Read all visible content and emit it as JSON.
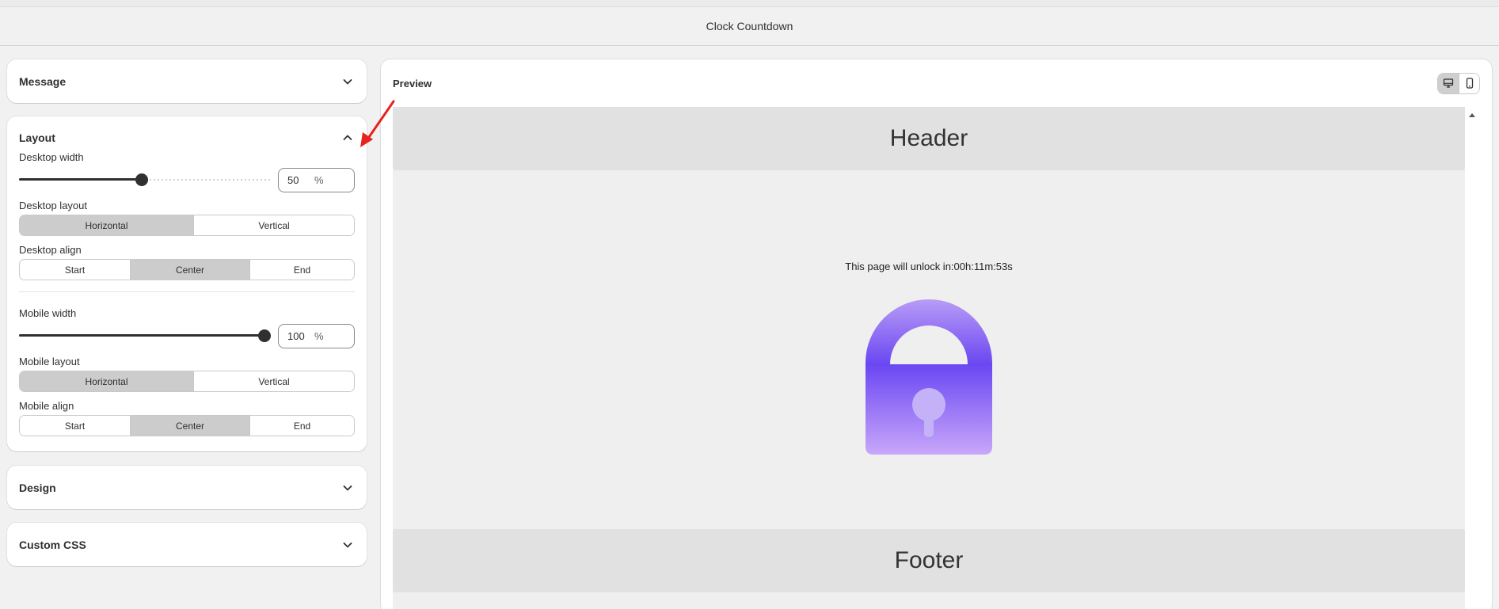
{
  "app": {
    "title": "Clock Countdown"
  },
  "sections": {
    "message": {
      "label": "Message",
      "icon": "chevron-down-icon"
    },
    "layout": {
      "label": "Layout",
      "icon": "chevron-up-icon",
      "desktop_width": {
        "label": "Desktop width",
        "value": "50",
        "unit": "%",
        "fraction": 0.5
      },
      "desktop_layout": {
        "label": "Desktop layout",
        "options": [
          "Horizontal",
          "Vertical"
        ],
        "selected": "Horizontal"
      },
      "desktop_align": {
        "label": "Desktop align",
        "options": [
          "Start",
          "Center",
          "End"
        ],
        "selected": "Center"
      },
      "mobile_width": {
        "label": "Mobile width",
        "value": "100",
        "unit": "%",
        "fraction": 1.0
      },
      "mobile_layout": {
        "label": "Mobile layout",
        "options": [
          "Horizontal",
          "Vertical"
        ],
        "selected": "Horizontal"
      },
      "mobile_align": {
        "label": "Mobile align",
        "options": [
          "Start",
          "Center",
          "End"
        ],
        "selected": "Center"
      }
    },
    "design": {
      "label": "Design",
      "icon": "chevron-down-icon"
    },
    "custom_css": {
      "label": "Custom CSS",
      "icon": "chevron-down-icon"
    }
  },
  "preview": {
    "title": "Preview",
    "device_toggle": {
      "options": [
        "desktop-icon",
        "mobile-icon"
      ],
      "selected": "desktop-icon"
    },
    "header_text": "Header",
    "message_text": "This page will unlock in:00h:11m:53s",
    "footer_text": "Footer",
    "lock_icon": "lock-icon",
    "lock_colors": {
      "top": "#b99cf6",
      "mid": "#6a47f2",
      "bottom": "#c8a7fa",
      "keyhole": "#c4b2f8"
    }
  },
  "annotation": {
    "icon": "red-arrow-icon",
    "color": "#e8221c"
  }
}
